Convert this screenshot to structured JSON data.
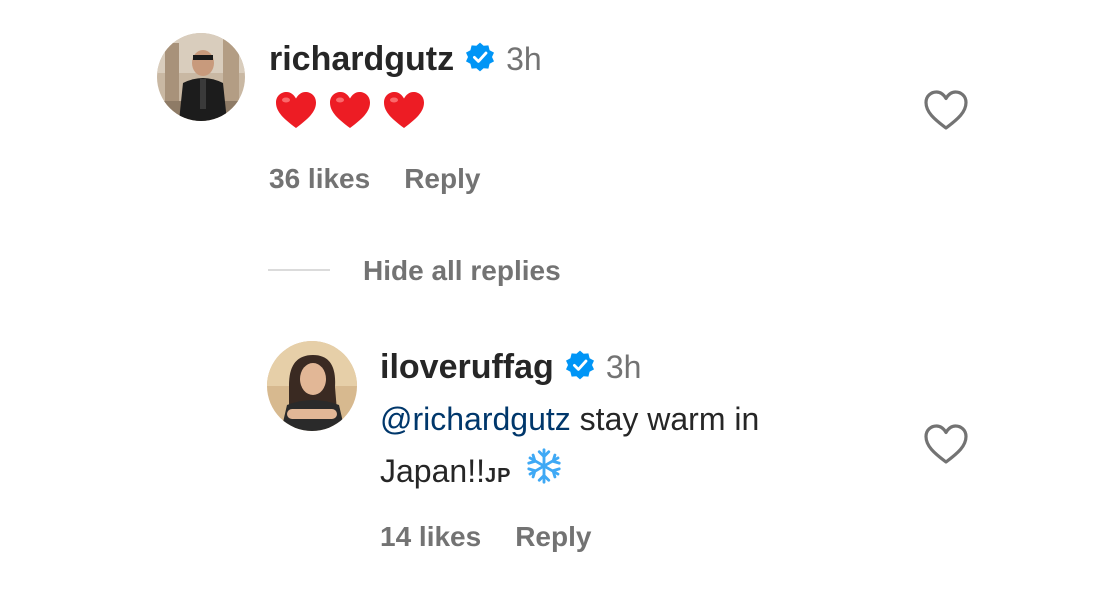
{
  "comment": {
    "username": "richardgutz",
    "time": "3h",
    "hearts": [
      "red-heart",
      "red-heart",
      "red-heart"
    ],
    "likes": "36 likes",
    "reply_label": "Reply"
  },
  "replies_toggle": {
    "label": "Hide all replies"
  },
  "reply": {
    "username": "iloveruffag",
    "time": "3h",
    "mention": "@richardgutz",
    "text_after_mention": " stay warm in",
    "text_line2": "Japan!!",
    "signature": "JP",
    "emoji": "snowflake",
    "likes": "14 likes",
    "reply_label": "Reply"
  },
  "colors": {
    "verified_blue": "#0095f6",
    "heart_red": "#ed1c24",
    "secondary_text": "#737373",
    "mention_blue": "#00376b",
    "snowflake": "#3fa9f5"
  }
}
